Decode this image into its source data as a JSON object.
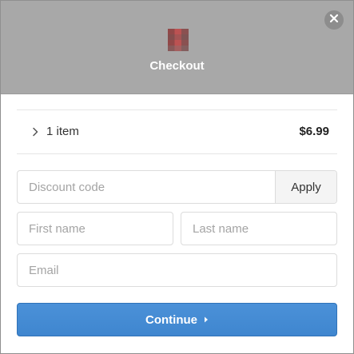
{
  "header": {
    "title": "Checkout",
    "close_icon": "close-icon"
  },
  "summary": {
    "items_label": "1 item",
    "total": "$6.99",
    "expand_icon": "chevron-right-icon"
  },
  "discount": {
    "placeholder": "Discount code",
    "value": "",
    "apply_label": "Apply"
  },
  "first_name": {
    "placeholder": "First name",
    "value": ""
  },
  "last_name": {
    "placeholder": "Last name",
    "value": ""
  },
  "email": {
    "placeholder": "Email",
    "value": ""
  },
  "continue": {
    "label": "Continue",
    "icon": "caret-right-icon"
  },
  "colors": {
    "header_bg": "#a8a8a8",
    "primary_button": "#4389d3",
    "close_button_bg": "#8d8d8d"
  }
}
